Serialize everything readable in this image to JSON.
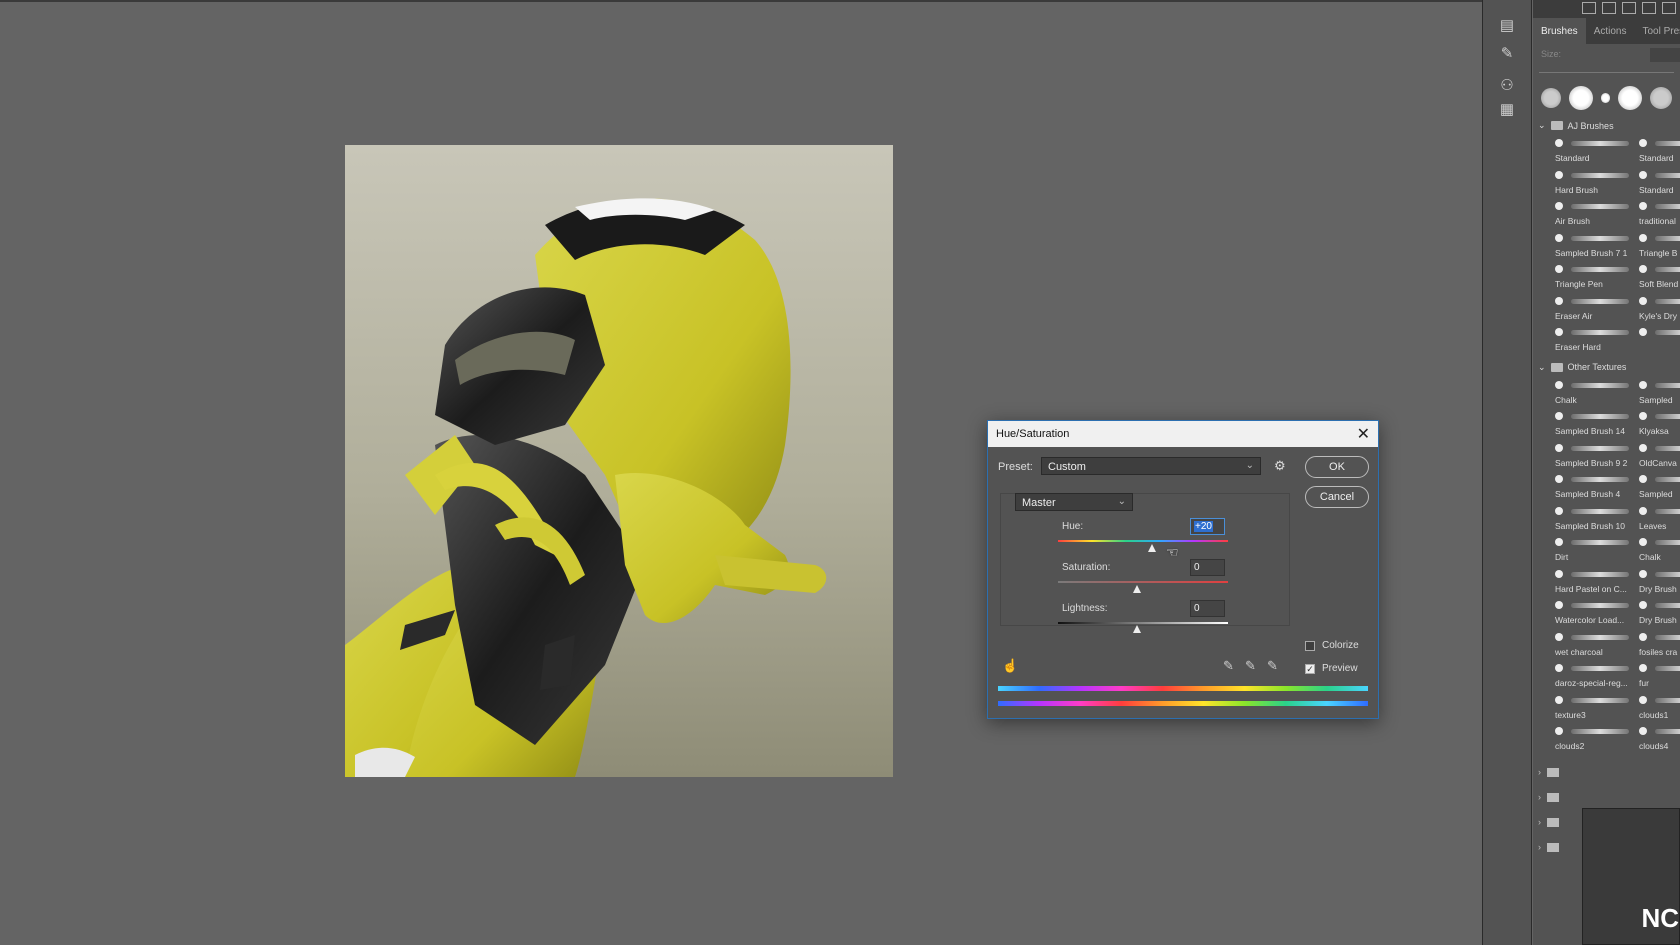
{
  "panel": {
    "tabs": [
      "Brushes",
      "Actions",
      "Tool Prese"
    ],
    "size_label": "Size:",
    "groups": [
      {
        "name": "AJ Brushes",
        "items": [
          "Standard",
          "Standard",
          "Hard Brush",
          "Standard",
          "Air Brush",
          "traditional",
          "Sampled Brush 7 1",
          "Triangle B",
          "Triangle Pen",
          "Soft Blend",
          "Eraser Air",
          "Kyle's Dry",
          "Eraser Hard",
          ""
        ]
      },
      {
        "name": "Other Textures",
        "items": [
          "Chalk",
          "Sampled",
          "Sampled Brush 14",
          "Klyaksa",
          "Sampled Brush 9 2",
          "OldCanva",
          "Sampled Brush 4",
          "Sampled",
          "Sampled Brush 10",
          "Leaves",
          "Dirt",
          "Chalk",
          "Hard Pastel on C...",
          "Dry Brush",
          "Watercolor Load...",
          "Dry Brush",
          "wet charcoal",
          "fosiles cra",
          "daroz-special-reg...",
          "fur",
          "texture3",
          "clouds1",
          "clouds2",
          "clouds4"
        ]
      }
    ],
    "preview_text": "NC"
  },
  "dialog": {
    "title": "Hue/Saturation",
    "preset_label": "Preset:",
    "preset_value": "Custom",
    "channel_value": "Master",
    "ok_label": "OK",
    "cancel_label": "Cancel",
    "hue_label": "Hue:",
    "hue_value": "+20",
    "hue_level": 20,
    "saturation_label": "Saturation:",
    "saturation_value": "0",
    "lightness_label": "Lightness:",
    "lightness_value": "0",
    "colorize_label": "Colorize",
    "colorize_checked": false,
    "preview_label": "Preview",
    "preview_checked": true
  }
}
